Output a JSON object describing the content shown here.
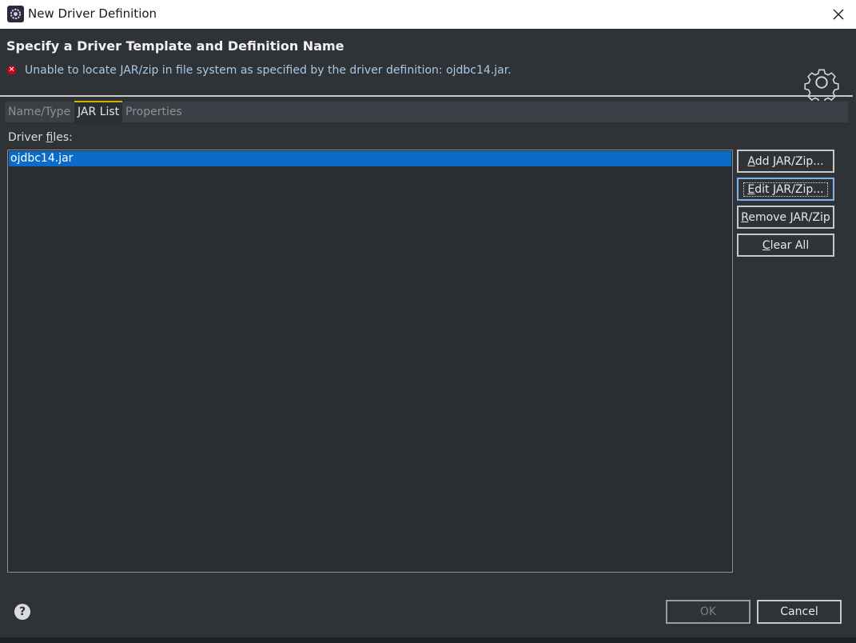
{
  "window": {
    "title": "New Driver Definition"
  },
  "banner": {
    "title": "Specify a Driver Template and Definition Name",
    "error": "Unable to locate JAR/zip in file system as specified by the driver definition: ojdbc14.jar."
  },
  "tabs": [
    {
      "label": "Name/Type",
      "active": false
    },
    {
      "label": "JAR List",
      "active": true
    },
    {
      "label": "Properties",
      "active": false
    }
  ],
  "driver_files": {
    "label_pre": "Driver ",
    "label_mnemonic": "f",
    "label_post": "iles:",
    "items": [
      "ojdbc14.jar"
    ],
    "selected": "ojdbc14.jar"
  },
  "buttons": {
    "add": {
      "mnemonic": "A",
      "rest": "dd JAR/Zip..."
    },
    "edit": {
      "mnemonic": "E",
      "rest": "dit JAR/Zip..."
    },
    "remove": {
      "mnemonic": "R",
      "rest": "emove JAR/Zip"
    },
    "clear": {
      "mnemonic": "C",
      "rest": "lear All"
    }
  },
  "footer": {
    "help": "?",
    "ok": "OK",
    "cancel": "Cancel"
  },
  "colors": {
    "background": "#2f3338",
    "selection": "#0a6bc9",
    "error": "#d0021b",
    "active_tab_accent": "#d4b000"
  }
}
